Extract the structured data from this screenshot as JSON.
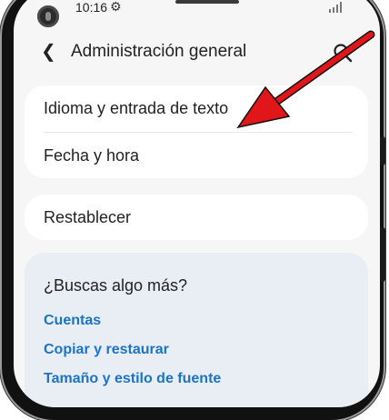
{
  "status_bar": {
    "time": "10:16",
    "settings_icon": "gear-icon",
    "signal_icon": "signal-icon"
  },
  "header": {
    "back_icon": "back-arrow-icon",
    "title": "Administración general",
    "search_icon": "search-icon"
  },
  "group1": {
    "items": [
      {
        "label": "Idioma y entrada de texto"
      },
      {
        "label": "Fecha y hora"
      }
    ]
  },
  "group2": {
    "items": [
      {
        "label": "Restablecer"
      }
    ]
  },
  "more": {
    "title": "¿Buscas algo más?",
    "links": [
      "Cuentas",
      "Copiar y restaurar",
      "Tamaño y estilo de fuente"
    ]
  },
  "colors": {
    "link": "#1b74c7",
    "annotation_arrow": "#e0161b",
    "card_background": "#ffffff",
    "more_background": "#e9eef4"
  },
  "annotation": {
    "type": "arrow",
    "points_to": "Idioma y entrada de texto"
  }
}
